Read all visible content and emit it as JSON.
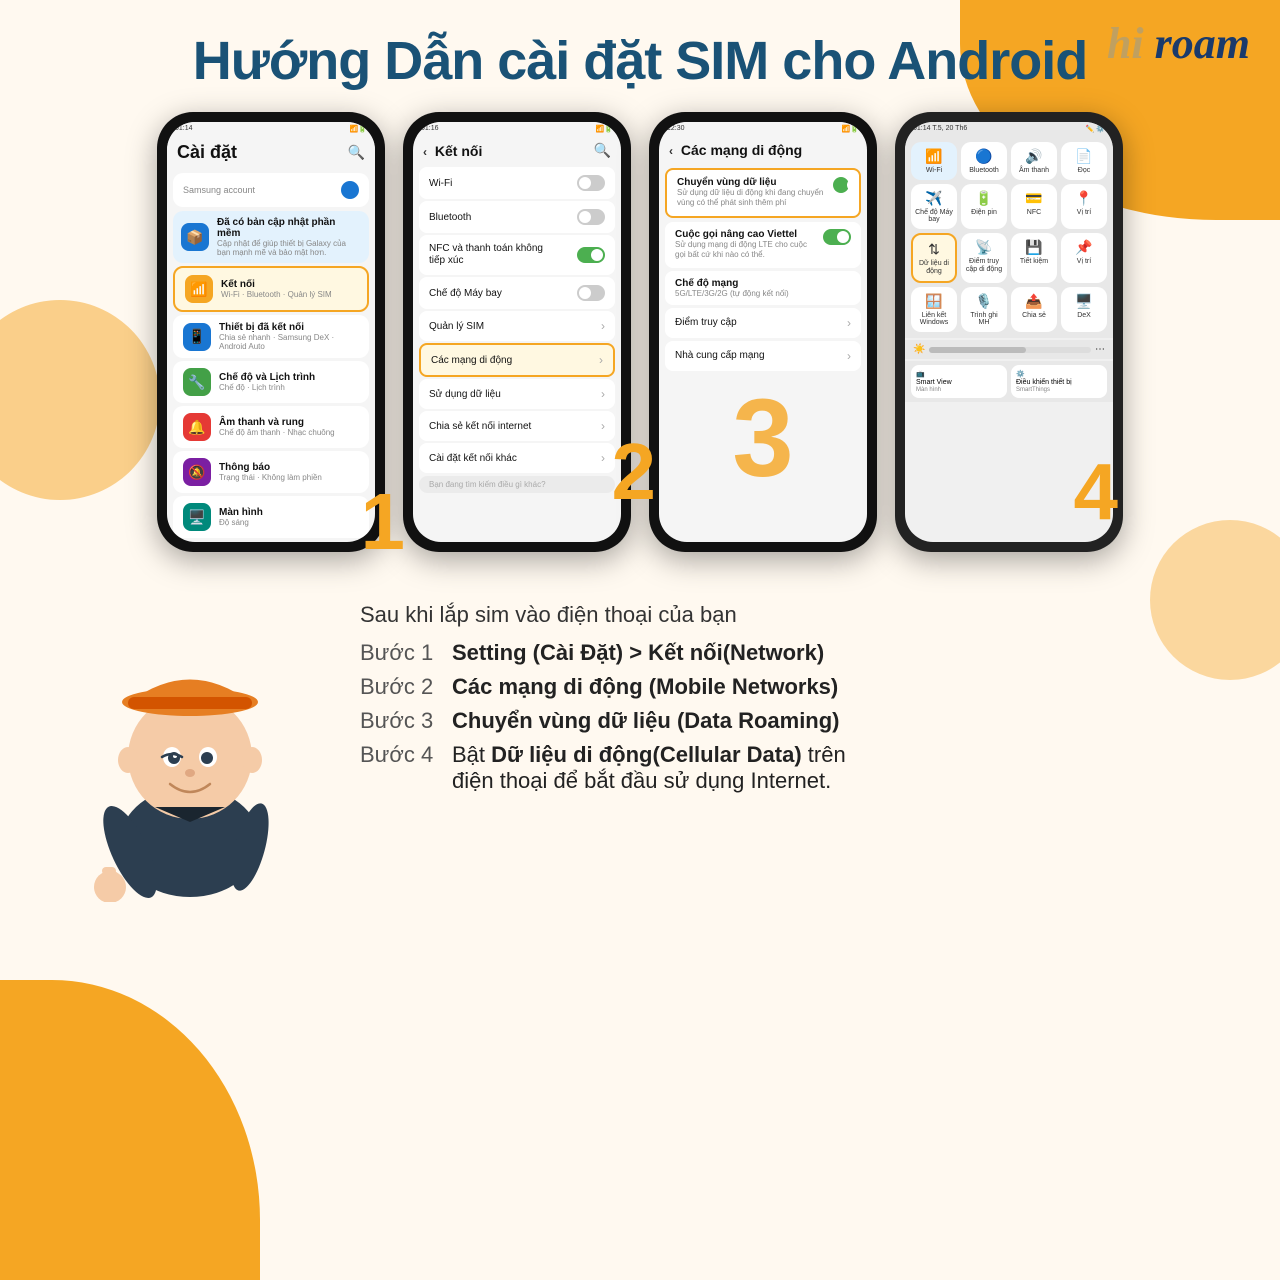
{
  "logo": {
    "text": "hi roam",
    "hi": "hi",
    "roam": "roam"
  },
  "title": "Hướng Dẫn cài đặt SIM cho Android",
  "phone1": {
    "time": "01:14",
    "screen_title": "Cài đặt",
    "samsung_account": "Samsung account",
    "items": [
      {
        "icon": "📦",
        "color": "blue",
        "title": "Đã có bản cập nhật phần mềm",
        "sub": "Cập nhật để giúp thiết bị Galaxy của bạn mạnh mẽ và bảo mật hơn.",
        "highlighted": false
      },
      {
        "icon": "📶",
        "color": "orange",
        "title": "Kết nối",
        "sub": "Wi-Fi · Bluetooth · Quản lý SIM",
        "highlighted": true
      },
      {
        "icon": "📱",
        "color": "blue",
        "title": "Thiết bị đã kết nối",
        "sub": "Chia sẻ nhanh · Samsung DeX · Android Auto",
        "highlighted": false
      },
      {
        "icon": "🔧",
        "color": "green",
        "title": "Chế độ và Lịch trình",
        "sub": "Chế độ · Lịch trình",
        "highlighted": false
      },
      {
        "icon": "🔔",
        "color": "red",
        "title": "Âm thanh và rung",
        "sub": "Chế độ âm thanh · Nhạc chuông",
        "highlighted": false
      },
      {
        "icon": "🔕",
        "color": "purple",
        "title": "Thông báo",
        "sub": "Trạng thái · Không làm phiền",
        "highlighted": false
      },
      {
        "icon": "🖥️",
        "color": "teal",
        "title": "Màn hình",
        "sub": "Độ sáng",
        "highlighted": false
      }
    ],
    "step": "1"
  },
  "phone2": {
    "time": "01:16",
    "screen_title": "Kết nối",
    "items": [
      {
        "title": "Wi-Fi",
        "toggle": false
      },
      {
        "title": "Bluetooth",
        "toggle": false
      },
      {
        "title": "NFC và thanh toán không tiếp xúc",
        "toggle": true
      },
      {
        "title": "Chế độ Máy bay",
        "toggle": false
      },
      {
        "title": "Quản lý SIM",
        "toggle": null
      },
      {
        "title": "Các mạng di động",
        "toggle": null,
        "highlighted": true
      },
      {
        "title": "Sử dụng dữ liệu",
        "toggle": null
      },
      {
        "title": "Chia sẻ kết nối internet",
        "toggle": null
      },
      {
        "title": "Cài đặt kết nối khác",
        "toggle": null
      }
    ],
    "search_placeholder": "Bạn đang tìm kiếm điều gì khác?",
    "step": "2"
  },
  "phone3": {
    "time": "12:30",
    "screen_title": "Các mạng di động",
    "items": [
      {
        "title": "Chuyển vùng dữ liệu",
        "sub": "Sử dụng dữ liệu di động khi đang chuyển vùng có thể phát sinh thêm phí",
        "toggle": true,
        "highlighted": true
      },
      {
        "title": "Cuộc gọi nâng cao Viettel",
        "sub": "Sử dụng mạng di động LTE cho cuộc gọi bất cứ khi nào có thể.",
        "toggle": true,
        "highlighted": false
      },
      {
        "title": "Chế độ mạng",
        "sub": "5G/LTE/3G/2G (tự động kết nối)",
        "toggle": null,
        "highlighted": false
      },
      {
        "title": "Điểm truy cập",
        "toggle": null,
        "highlighted": false
      },
      {
        "title": "Nhà cung cấp mạng",
        "toggle": null,
        "highlighted": false
      }
    ],
    "step": "3"
  },
  "phone4": {
    "time": "01:14 T.5, 20 Th6",
    "items_row1": [
      {
        "icon": "📶",
        "label": "Wi-Fi",
        "active": true
      },
      {
        "icon": "🔊",
        "label": "Âm thanh",
        "active": false
      },
      {
        "icon": "✈️",
        "label": "Chế độ Máy bay",
        "active": false
      },
      {
        "icon": "🔋",
        "label": "Điện pin",
        "active": false
      }
    ],
    "items_row2": [
      {
        "icon": "📡",
        "label": "Dữ liệu di động",
        "active": false,
        "highlighted": true
      },
      {
        "icon": "📍",
        "label": "Điểm truy cập di động",
        "active": false
      },
      {
        "icon": "💾",
        "label": "Tiết kiệm",
        "active": false
      },
      {
        "icon": "📌",
        "label": "Vị trí",
        "active": false
      }
    ],
    "step": "4"
  },
  "bottom": {
    "intro": "Sau khi lắp sim vào điện thoại của bạn",
    "steps": [
      {
        "label": "Bước 1",
        "desc": "Setting (Cài Đặt) > Kết nối(Network)"
      },
      {
        "label": "Bước 2",
        "desc": "Các mạng di động (Mobile Networks)"
      },
      {
        "label": "Bước 3",
        "desc": "Chuyển vùng dữ liệu (Data Roaming)"
      },
      {
        "label": "Bước 4",
        "desc_plain": "Bật ",
        "desc_bold": "Dữ liệu di động(Cellular Data)",
        "desc_after": " trên điện thoại để bắt đầu sử dụng Internet."
      }
    ]
  }
}
